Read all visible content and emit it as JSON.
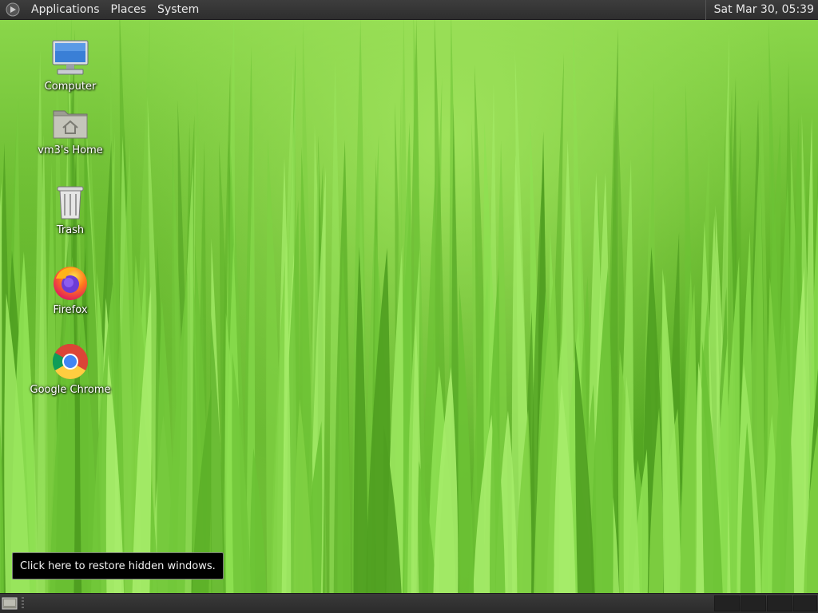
{
  "top_panel": {
    "menus": [
      {
        "label": "Applications"
      },
      {
        "label": "Places"
      },
      {
        "label": "System"
      }
    ],
    "clock": "Sat Mar 30, 05:39"
  },
  "desktop_icons": [
    {
      "label": "Computer",
      "icon": "computer-icon"
    },
    {
      "label": "vm3's Home",
      "icon": "home-folder-icon"
    },
    {
      "label": "Trash",
      "icon": "trash-icon"
    },
    {
      "label": "Firefox",
      "icon": "firefox-icon"
    },
    {
      "label": "Google Chrome",
      "icon": "chrome-icon"
    }
  ],
  "tooltip": {
    "text": "Click here to restore hidden windows."
  },
  "colors": {
    "panel": "#2e2e2e",
    "wallpaper_green": "#5fb52a"
  }
}
